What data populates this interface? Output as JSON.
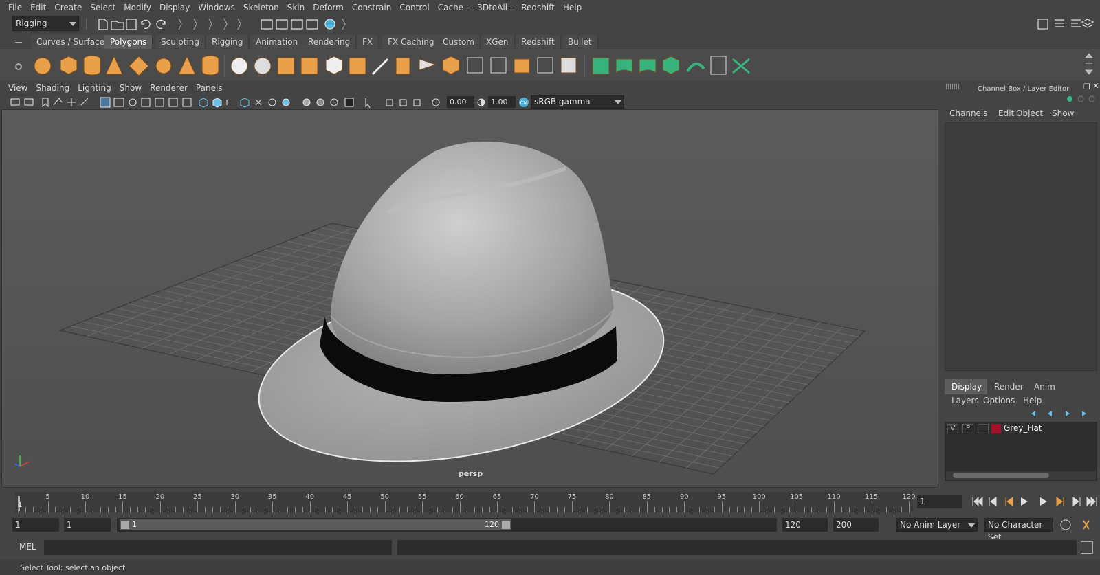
{
  "menubar": {
    "items": [
      "File",
      "Edit",
      "Create",
      "Select",
      "Modify",
      "Display",
      "Windows",
      "Skeleton",
      "Skin",
      "Deform",
      "Constrain",
      "Control",
      "Cache",
      "- 3DtoAll -",
      "Redshift",
      "Help"
    ]
  },
  "statusline": {
    "mode": "Rigging"
  },
  "shelf": {
    "tabs": [
      "Curves / Surfaces",
      "Polygons",
      "Sculpting",
      "Rigging",
      "Animation",
      "Rendering",
      "FX",
      "FX Caching",
      "Custom",
      "XGen",
      "Redshift",
      "Bullet"
    ],
    "active_tab": "Polygons",
    "accent_color": "#e8a04a",
    "accent_color_2": "#39b37d"
  },
  "viewport": {
    "menu": [
      "View",
      "Shading",
      "Lighting",
      "Show",
      "Renderer",
      "Panels"
    ],
    "exposure": "0.00",
    "gamma": "1.00",
    "color_space": "sRGB gamma",
    "camera_label": "persp"
  },
  "channel_box": {
    "title": "Channel Box / Layer Editor",
    "menu": [
      "Channels",
      "Edit",
      "Object",
      "Show"
    ]
  },
  "layer_editor": {
    "tabs": [
      "Display",
      "Render",
      "Anim"
    ],
    "active_tab": "Display",
    "menu": [
      "Layers",
      "Options",
      "Help"
    ],
    "layers": [
      {
        "v": "V",
        "p": "P",
        "name": "Grey_Hat",
        "color": "#a3122d"
      }
    ]
  },
  "time_slider": {
    "ticks": [
      "5",
      "10",
      "15",
      "20",
      "25",
      "30",
      "35",
      "40",
      "45",
      "50",
      "55",
      "60",
      "65",
      "70",
      "75",
      "80",
      "85",
      "90",
      "95",
      "100",
      "105",
      "110",
      "115",
      "120"
    ],
    "start_marker": "1",
    "current_frame": "1"
  },
  "range_slider": {
    "start": "1",
    "playback_start": "1",
    "slider_start": "1",
    "slider_end": "120",
    "playback_end": "120",
    "end": "200",
    "anim_layer": "No Anim Layer",
    "character_set": "No Character Set"
  },
  "command_line": {
    "label": "MEL"
  },
  "help_line": {
    "text": "Select Tool: select an object"
  }
}
